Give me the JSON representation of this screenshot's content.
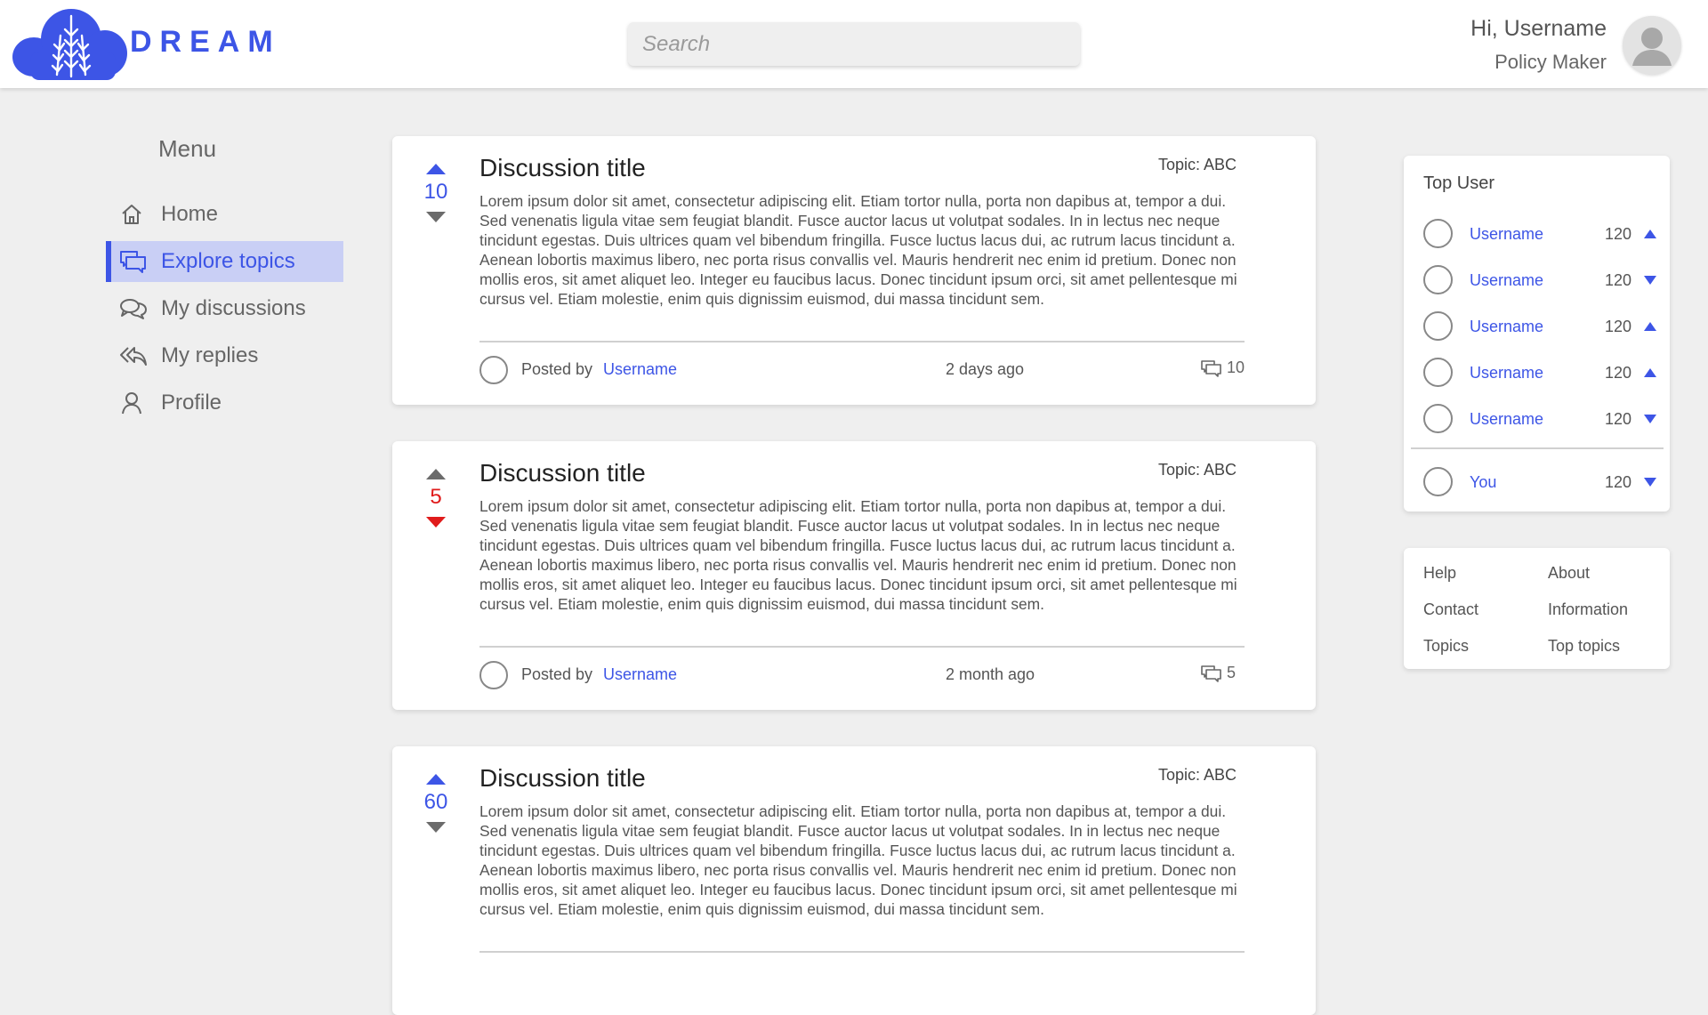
{
  "header": {
    "brand": "DREAM",
    "search_placeholder": "Search",
    "greeting": "Hi, Username",
    "role": "Policy Maker"
  },
  "sidebar": {
    "title": "Menu",
    "items": [
      {
        "label": "Home",
        "icon": "home-icon"
      },
      {
        "label": "Explore topics",
        "icon": "chat-bubbles-icon",
        "active": true
      },
      {
        "label": "My discussions",
        "icon": "conversation-icon"
      },
      {
        "label": "My replies",
        "icon": "reply-all-icon"
      },
      {
        "label": "Profile",
        "icon": "person-icon"
      }
    ]
  },
  "discussions": [
    {
      "votes": "10",
      "vote_state": "up",
      "title": "Discussion title",
      "topic": "Topic: ABC",
      "body": "Lorem ipsum dolor sit amet, consectetur adipiscing elit. Etiam tortor nulla, porta non dapibus at, tempor a dui. Sed venenatis ligula vitae sem feugiat blandit. Fusce auctor lacus ut volutpat sodales. In in lectus nec neque tincidunt egestas. Duis ultrices quam vel bibendum fringilla. Fusce luctus lacus dui, ac rutrum lacus tincidunt a. Aenean lobortis maximus libero, nec porta risus convallis vel. Mauris hendrerit nec enim id pretium. Donec non mollis eros, sit amet aliquet leo. Integer eu faucibus lacus. Donec tincidunt ipsum orci, sit amet pellentesque mi cursus vel. Etiam molestie, enim quis dignissim euismod, dui massa tincidunt sem.",
      "posted_by_label": "Posted by",
      "author": "Username",
      "time": "2 days ago",
      "comments": "10"
    },
    {
      "votes": "5",
      "vote_state": "down",
      "title": "Discussion title",
      "topic": "Topic: ABC",
      "body": "Lorem ipsum dolor sit amet, consectetur adipiscing elit. Etiam tortor nulla, porta non dapibus at, tempor a dui. Sed venenatis ligula vitae sem feugiat blandit. Fusce auctor lacus ut volutpat sodales. In in lectus nec neque tincidunt egestas. Duis ultrices quam vel bibendum fringilla. Fusce luctus lacus dui, ac rutrum lacus tincidunt a. Aenean lobortis maximus libero, nec porta risus convallis vel. Mauris hendrerit nec enim id pretium. Donec non mollis eros, sit amet aliquet leo. Integer eu faucibus lacus. Donec tincidunt ipsum orci, sit amet pellentesque mi cursus vel. Etiam molestie, enim quis dignissim euismod, dui massa tincidunt sem.",
      "posted_by_label": "Posted by",
      "author": "Username",
      "time": "2 month ago",
      "comments": "5"
    },
    {
      "votes": "60",
      "vote_state": "up",
      "title": "Discussion title",
      "topic": "Topic: ABC",
      "body": "Lorem ipsum dolor sit amet, consectetur adipiscing elit. Etiam tortor nulla, porta non dapibus at, tempor a dui. Sed venenatis ligula vitae sem feugiat blandit. Fusce auctor lacus ut volutpat sodales. In in lectus nec neque tincidunt egestas. Duis ultrices quam vel bibendum fringilla. Fusce luctus lacus dui, ac rutrum lacus tincidunt a. Aenean lobortis maximus libero, nec porta risus convallis vel. Mauris hendrerit nec enim id pretium. Donec non mollis eros, sit amet aliquet leo. Integer eu faucibus lacus. Donec tincidunt ipsum orci, sit amet pellentesque mi cursus vel. Etiam molestie, enim quis dignissim euismod, dui massa tincidunt sem."
    }
  ],
  "top_users": {
    "title": "Top User",
    "users": [
      {
        "name": "Username",
        "score": "120",
        "trend": "up"
      },
      {
        "name": "Username",
        "score": "120",
        "trend": "down"
      },
      {
        "name": "Username",
        "score": "120",
        "trend": "up"
      },
      {
        "name": "Username",
        "score": "120",
        "trend": "up"
      },
      {
        "name": "Username",
        "score": "120",
        "trend": "down"
      }
    ],
    "you": {
      "name": "You",
      "score": "120",
      "trend": "down"
    }
  },
  "footer_links": {
    "help": "Help",
    "about": "About",
    "contact": "Contact",
    "information": "Information",
    "topics": "Topics",
    "top_topics": "Top topics"
  },
  "colors": {
    "accent": "#3d55e6",
    "active_bg": "#c9cff5",
    "downvote": "#e01b1b",
    "neutral_arrow": "#6b6b6b",
    "background": "#efefef"
  }
}
